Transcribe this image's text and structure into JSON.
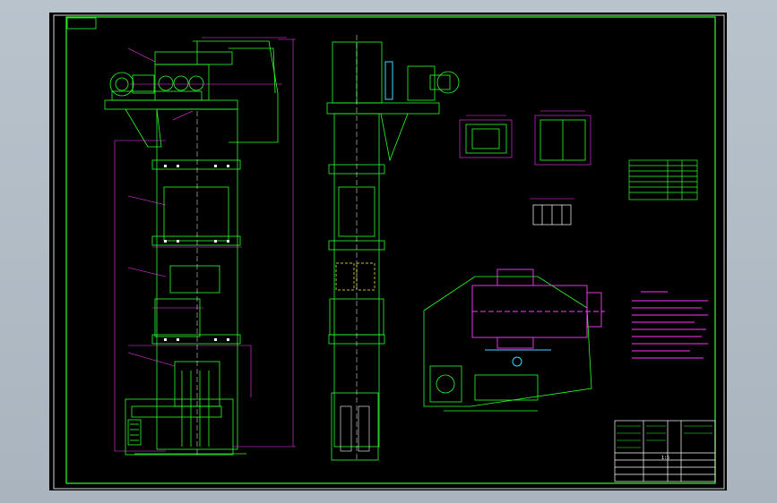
{
  "drawing": {
    "title_block": {
      "scale": "1:5"
    },
    "colors": {
      "background": "#000000",
      "frame": "#2bff2b",
      "outline": "#2bff2b",
      "dimension": "#ff39ff",
      "centerline": "#ffffff",
      "detail": "#ffff33",
      "accent": "#3fd7ff"
    }
  }
}
